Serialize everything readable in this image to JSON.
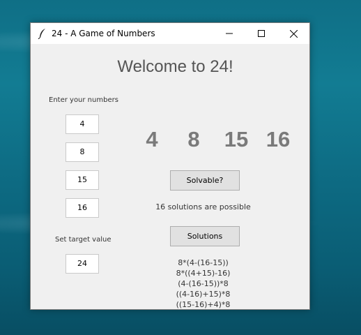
{
  "window": {
    "title": "24 - A Game of Numbers"
  },
  "main": {
    "heading": "Welcome to 24!",
    "numbers_label": "Enter your numbers",
    "inputs": [
      "4",
      "8",
      "15",
      "16"
    ],
    "target_label": "Set target value",
    "target_value": "24",
    "display_numbers": [
      "4",
      "8",
      "15",
      "16"
    ],
    "solvable_button": "Solvable?",
    "status": "16 solutions are possible",
    "solutions_button": "Solutions",
    "solutions": [
      "8*(4-(16-15))",
      "8*((4+15)-16)",
      "(4-(16-15))*8",
      "((4-16)+15)*8",
      "((15-16)+4)*8"
    ]
  },
  "colors": {
    "display_number": "#7a7a7a",
    "window_bg": "#f0f0f0",
    "desktop": "#0f6f86"
  },
  "icons": {
    "app": "feather-icon",
    "minimize": "minimize-icon",
    "maximize": "maximize-icon",
    "close": "close-icon"
  }
}
